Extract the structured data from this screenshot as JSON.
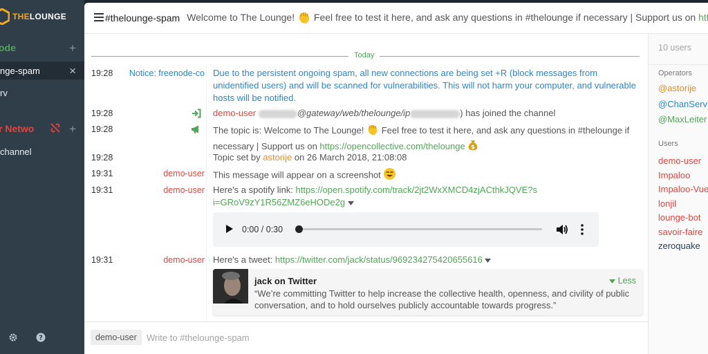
{
  "sidebar": {
    "logo_the": "THE",
    "logo_lounge": "LOUNGE",
    "networks": [
      {
        "name": "ode",
        "add": "+"
      },
      {
        "name": "r Netwo",
        "add": "+"
      }
    ],
    "channels": [
      {
        "name": "nge-spam",
        "close": "×"
      },
      {
        "name": "rv"
      },
      {
        "name": "channel"
      }
    ]
  },
  "header": {
    "channel": "#thelounge-spam",
    "topic_a": "Welcome to The Lounge!",
    "topic_b": "Feel free to test it here, and ask any questions in #thelounge if necessary | Support us on",
    "topic_link": "https://ope"
  },
  "day_divider": "Today",
  "messages": [
    {
      "time": "19:28",
      "from": "Notice: freenode-co",
      "text": "Due to the persistent ongoing spam, all new connections are being set +R (block messages from unidentified users) and will be scanned for vulnerabilities. This will not harm your computer, and vulnerable hosts will be notified."
    },
    {
      "time": "19:28",
      "nick": "demo-user",
      "host_mid": "@gateway/web/thelounge/ip",
      "tail": ") has joined the channel"
    },
    {
      "time": "19:28",
      "text_a": "The topic is: Welcome to The Lounge!",
      "text_b": "Feel free to test it here, and ask any questions in #thelounge if necessary | Support us on",
      "link": "https://opencollective.com/thelounge"
    },
    {
      "time": "19:28",
      "text_a": "Topic set by",
      "nick": "astorije",
      "text_b": "on 26 March 2018, 21:08:08"
    },
    {
      "time": "19:31",
      "from": "demo-user",
      "text": "This message will appear on a screenshot"
    },
    {
      "time": "19:31",
      "from": "demo-user",
      "text": "Here's a spotify link:",
      "link": "https://open.spotify.com/track/2jt2WxXMCD4zjACthkJQVE?si=GRoV9zY1R56ZMZ6eHODe2g"
    },
    {
      "time": "19:31",
      "from": "demo-user",
      "text": "Here's a tweet:",
      "link": "https://twitter.com/jack/status/969234275420655616"
    }
  ],
  "audio": {
    "time": "0:00 / 0:30",
    "progress": 0
  },
  "card": {
    "title": "jack on Twitter",
    "desc": "“We’re committing Twitter to help increase the collective health, openness, and civility of public conversation, and to hold ourselves publicly accountable towards progress.”",
    "less": "Less"
  },
  "userlist": {
    "search_placeholder": "10 users",
    "operators_label": "Operators",
    "operators": [
      "@astorije",
      "@ChanServ",
      "@MaxLeiter"
    ],
    "users_label": "Users",
    "users": [
      {
        "name": "demo-user",
        "color": "#e0443c"
      },
      {
        "name": "Impaloo",
        "color": "#e0443c"
      },
      {
        "name": "Impaloo-Vue",
        "color": "#e0443c"
      },
      {
        "name": "lonjil",
        "color": "#e0443c"
      },
      {
        "name": "lounge-bot",
        "color": "#e0443c"
      },
      {
        "name": "savoir-faire",
        "color": "#e0443c"
      },
      {
        "name": "zeroquake",
        "color": "#2c3e5a"
      }
    ]
  },
  "input": {
    "nick": "demo-user",
    "placeholder": "Write to #thelounge-spam"
  },
  "colors": {
    "accent_green": "#50a656",
    "notice_blue": "#2a87ca",
    "nick_red": "#e0443c",
    "op_orange": "#e68d24",
    "sidebar": "#303e4a"
  }
}
